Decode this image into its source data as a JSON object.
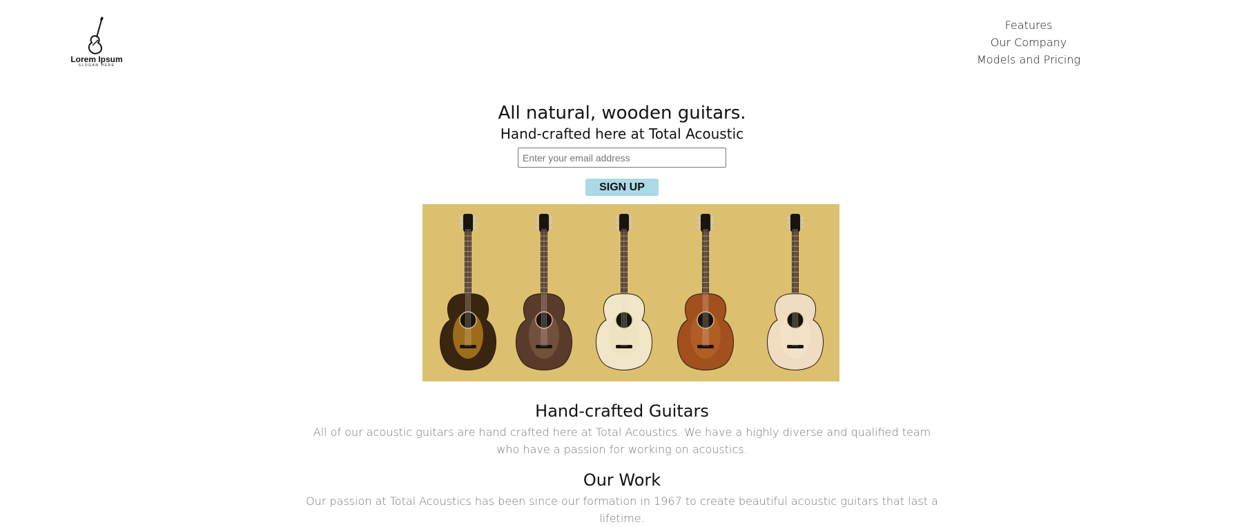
{
  "logo": {
    "brand": "Lorem Ipsum",
    "slogan": "SLOGAN HERE",
    "icon": "guitar-icon"
  },
  "nav": {
    "items": [
      {
        "label": "Features"
      },
      {
        "label": "Our Company"
      },
      {
        "label": "Models and Pricing"
      }
    ]
  },
  "hero": {
    "headline": "All natural, wooden guitars.",
    "subheadline": "Hand-crafted here at Total Acoustic",
    "email_placeholder": "Enter your email address",
    "signup_label": "SIGN UP",
    "signup_color": "#add8e6"
  },
  "banner": {
    "background_color": "#dcc070",
    "guitars": [
      {
        "name": "sunburst-dreadnought",
        "body": "#3a2510",
        "center": "#c88a20"
      },
      {
        "name": "striped-cutaway",
        "body": "#5a3a2a",
        "center": "#7a5a44"
      },
      {
        "name": "natural-cutaway",
        "body": "#f2e6c8",
        "center": "#efe1bd"
      },
      {
        "name": "mahogany-grand",
        "body": "#a2501e",
        "center": "#b8622a"
      },
      {
        "name": "spruce-cutaway",
        "body": "#f0dcc0",
        "center": "#f3e3cc"
      }
    ]
  },
  "sections": [
    {
      "title": "Hand-crafted Guitars",
      "text": "All of our acoustic guitars are hand crafted here at Total Acoustics. We have a highly diverse and qualified team who have a passion for working on acoustics."
    },
    {
      "title": "Our Work",
      "text": "Our passion at Total Acoustics has been since our formation in 1967 to create beautiful acoustic guitars that last a lifetime."
    }
  ]
}
